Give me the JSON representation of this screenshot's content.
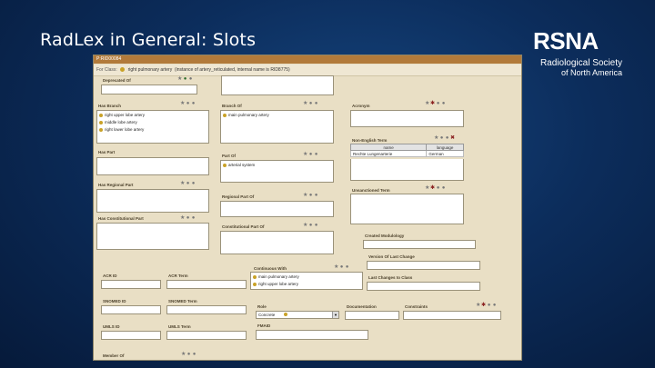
{
  "slide": {
    "title": "RadLex in General: Slots"
  },
  "logo": {
    "wordmark": "RSNA",
    "line1": "Radiological Society",
    "line2": "of North America"
  },
  "app": {
    "titlebar": "P:RID00084",
    "header_label": "For Class:",
    "header_value": "right pulmonary artery",
    "header_extra": "(instance of artery_reticulated, internal name is RID8775)",
    "left": {
      "deprecated_label": "Deprecated Of",
      "has_branch_label": "Has Branch",
      "has_branch_items": [
        "right upper lobe artery",
        "middle lobe artery",
        "right lower lobe artery"
      ],
      "has_part_label": "Has Part",
      "has_regional_part_label": "Has Regional Part",
      "has_constitutional_part_label": "Has Constitutional Part",
      "acr_id_label": "ACR ID",
      "snomed_id_label": "SNOMED ID",
      "umls_id_label": "UMLS ID",
      "member_of_label": "Member Of"
    },
    "middle": {
      "branch_of_label": "Branch Of",
      "branch_of_items": [
        "main pulmonary artery"
      ],
      "part_of_label": "Part Of",
      "part_of_items": [
        "arterial system"
      ],
      "regional_part_of_label": "Regional Part Of",
      "constitutional_part_of_label": "Constitutional Part Of",
      "acr_term_label": "ACR Term",
      "snomed_term_label": "SNOMED Term",
      "umls_term_label": "UMLS Term",
      "continuous_with_label": "Continuous With",
      "continuous_with_items": [
        "main pulmonary artery",
        "right upper lobe artery"
      ],
      "role_label": "Role",
      "role_value": "Concrete",
      "fmaid_label": "FMAID"
    },
    "right": {
      "acronym_label": "Acronym",
      "non_english_label": "Non-English Term",
      "non_english_columns": [
        "name",
        "language"
      ],
      "non_english_rows": [
        [
          "Rechte Lungenarterie",
          "German"
        ]
      ],
      "unsanctioned_label": "Unsanctioned Term",
      "created_mod_label": "Created Modulology",
      "version_last_change_label": "Version Of Last Change",
      "last_changes_label": "Last Changes to Class",
      "documentation_label": "Documentation",
      "constraints_label": "Constraints"
    },
    "icons": {
      "view": "★",
      "add": "●",
      "remove": "●",
      "delete": "✖",
      "create": "✱",
      "edit": "✎"
    },
    "colors": {
      "titlebar": "#b27a3a",
      "panel": "#e9dfc5",
      "instance_dot": "#c9a227"
    }
  }
}
